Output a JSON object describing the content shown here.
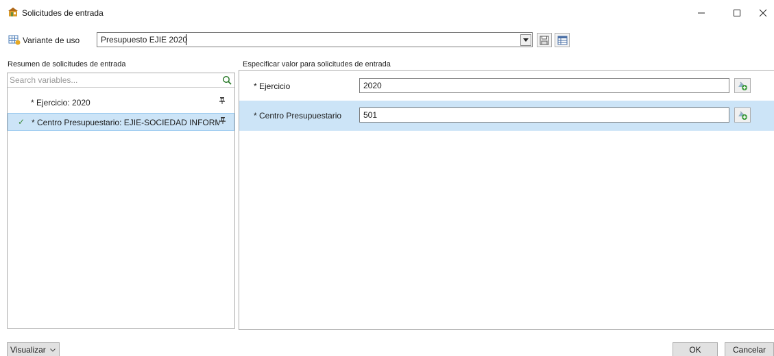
{
  "window": {
    "title": "Solicitudes de entrada",
    "minimize_glyph": "—",
    "maximize_glyph": "☐",
    "close_glyph": "✕"
  },
  "variant": {
    "label": "Variante de uso",
    "value": "Presupuesto EJIE 2020"
  },
  "left_panel": {
    "header": "Resumen de solicitudes de entrada",
    "search_placeholder": "Search variables...",
    "items": [
      {
        "label": "* Ejercicio: 2020",
        "selected": false
      },
      {
        "label": "* Centro Presupuestario: EJIE-SOCIEDAD INFORMATICA",
        "selected": true
      }
    ]
  },
  "right_panel": {
    "header": "Especificar valor para solicitudes de entrada",
    "rows": [
      {
        "label": "* Ejercicio",
        "value": "2020"
      },
      {
        "label": "* Centro Presupuestario",
        "value": "501"
      }
    ]
  },
  "footer": {
    "visualizar_label": "Visualizar",
    "ok_label": "OK",
    "cancel_label": "Cancelar"
  },
  "colors": {
    "selection": "#cce4f7",
    "check": "#3b8a3b"
  }
}
